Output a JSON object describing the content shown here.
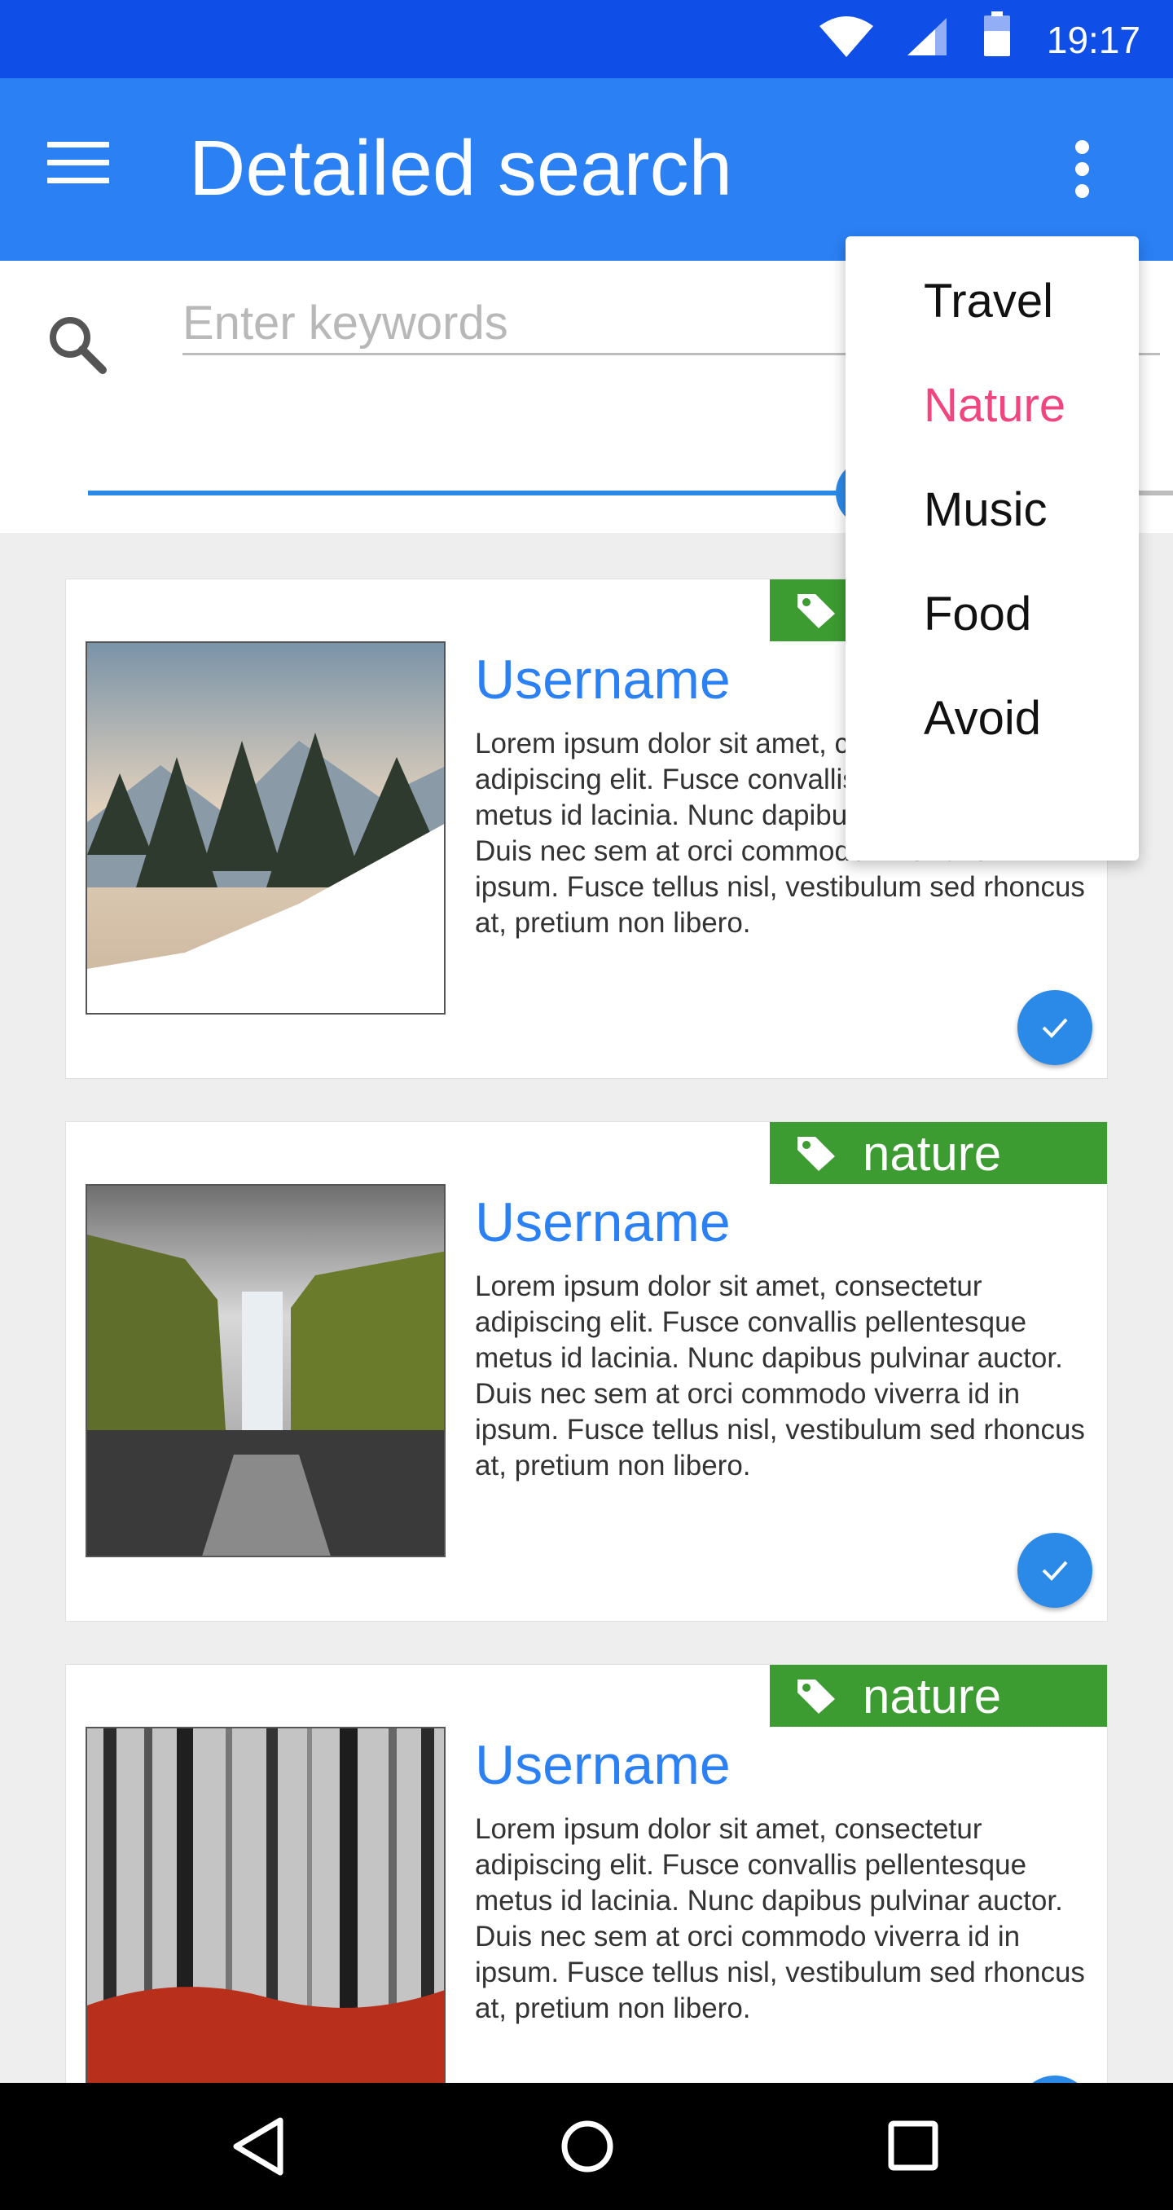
{
  "status_bar": {
    "time": "19:17",
    "icons": [
      "wifi-icon",
      "signal-icon",
      "battery-icon"
    ]
  },
  "app_bar": {
    "title": "Detailed search",
    "menu_icon": "hamburger-menu-icon",
    "more_icon": "more-vertical-icon"
  },
  "search": {
    "placeholder": "Enter keywords",
    "value": "",
    "icon": "search-icon",
    "slider_fraction": 0.72
  },
  "dropdown": {
    "items": [
      {
        "label": "Travel",
        "selected": false
      },
      {
        "label": "Nature",
        "selected": true
      },
      {
        "label": "Music",
        "selected": false
      },
      {
        "label": "Food",
        "selected": false
      },
      {
        "label": "Avoid",
        "selected": false
      }
    ]
  },
  "cards": [
    {
      "tag": "nature",
      "username": "Username",
      "description": "Lorem ipsum dolor sit amet, consectetur adipiscing elit. Fusce convallis pellentesque metus id lacinia. Nunc dapibus pulvinar auctor. Duis nec sem at orci commodo viverra id in ipsum. Fusce tellus nisl, vestibulum sed rhoncus at, pretium non libero.",
      "image": "snowy-forest-mountain",
      "checked": true
    },
    {
      "tag": "nature",
      "username": "Username",
      "description": "Lorem ipsum dolor sit amet, consectetur adipiscing elit. Fusce convallis pellentesque metus id lacinia. Nunc dapibus pulvinar auctor. Duis nec sem at orci commodo viverra id in ipsum. Fusce tellus nisl, vestibulum sed rhoncus at, pretium non libero.",
      "image": "waterfall-cliffs",
      "checked": true
    },
    {
      "tag": "nature",
      "username": "Username",
      "description": "Lorem ipsum dolor sit amet, consectetur adipiscing elit. Fusce convallis pellentesque metus id lacinia. Nunc dapibus pulvinar auctor. Duis nec sem at orci commodo viverra id in ipsum. Fusce tellus nisl, vestibulum sed rhoncus at, pretium non libero.",
      "image": "misty-red-forest",
      "checked": true
    }
  ],
  "colors": {
    "status_bar": "#0f4fe8",
    "app_bar": "#2b80f4",
    "accent": "#2b8ae8",
    "tag_green": "#3c9b31",
    "selected_pink": "#f0457f"
  },
  "nav_bar": {
    "buttons": [
      "back-icon",
      "home-icon",
      "recents-icon"
    ]
  }
}
